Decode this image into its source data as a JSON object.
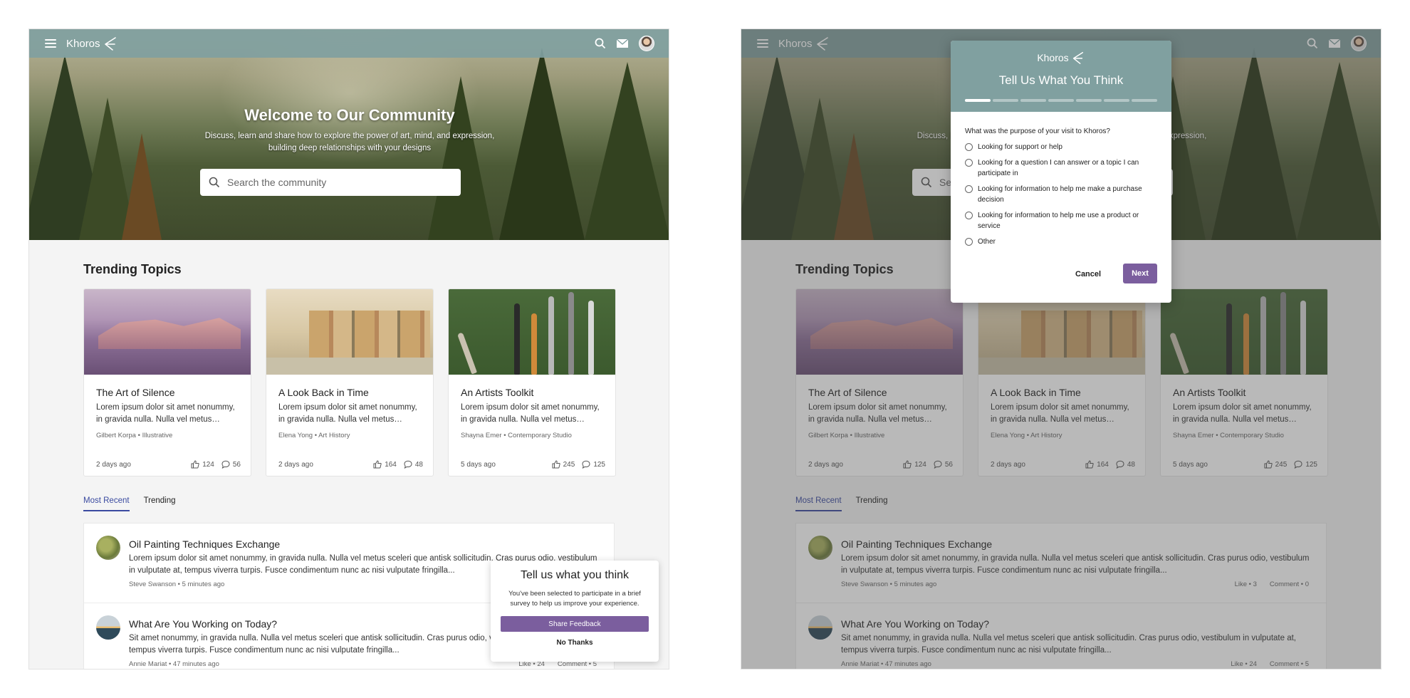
{
  "brand": {
    "name": "Khoros"
  },
  "hero": {
    "title": "Welcome to Our Community",
    "subtitle": "Discuss, learn and share how to explore the power of art, mind, and expression, building deep relationships with your designs",
    "search_placeholder": "Search the community"
  },
  "trending": {
    "title": "Trending Topics",
    "cards": [
      {
        "title": "The Art of Silence",
        "desc": "Lorem ipsum dolor sit amet nonummy, in gravida nulla. Nulla vel metus…",
        "meta": "Gilbert Korpa • Illustrative",
        "time": "2 days ago",
        "likes": "124",
        "comments": "56"
      },
      {
        "title": "A Look Back in Time",
        "desc": "Lorem ipsum dolor sit amet nonummy, in gravida nulla. Nulla vel metus…",
        "meta": "Elena Yong • Art History",
        "time": "2 days ago",
        "likes": "164",
        "comments": "48"
      },
      {
        "title": "An Artists Toolkit",
        "desc": "Lorem ipsum dolor sit amet nonummy, in gravida nulla. Nulla vel metus…",
        "meta": "Shayna Emer • Contemporary Studio",
        "time": "5 days ago",
        "likes": "245",
        "comments": "125"
      }
    ]
  },
  "tabs": {
    "most_recent": "Most Recent",
    "trending": "Trending"
  },
  "posts": [
    {
      "title": "Oil Painting Techniques Exchange",
      "body": "Lorem ipsum dolor sit amet nonummy, in gravida nulla. Nulla vel metus sceleri que antisk sollicitudin. Cras purus odio, vestibulum in vulputate at, tempus viverra turpis. Fusce condimentum nunc ac nisi vulputate fringilla...",
      "meta": "Steve Swanson • 5 minutes ago",
      "likes": "Like • 3",
      "comments": "Comment • 0"
    },
    {
      "title": "What Are You Working on Today?",
      "body": "Sit amet nonummy, in gravida nulla. Nulla vel metus sceleri que antisk sollicitudin. Cras purus odio, vestibulum in vulputate at, tempus viverra turpis. Fusce condimentum nunc ac nisi vulputate fringilla...",
      "meta": "Annie Mariat • 47 minutes ago",
      "likes": "Like • 24",
      "comments": "Comment • 5"
    }
  ],
  "toast": {
    "title": "Tell us what you think",
    "text": "You've been selected to participate in a brief survey to help us improve your experience.",
    "share_button": "Share Feedback",
    "no_thanks": "No Thanks"
  },
  "survey": {
    "title": "Tell Us What You Think",
    "steps_total": 7,
    "steps_done": 1,
    "question": "What was the purpose of your visit to Khoros?",
    "options": [
      "Looking for support or help",
      "Looking for a question I can answer or a topic I can participate in",
      "Looking for information to help me make a purchase decision",
      "Looking for information to help me use a product or service",
      "Other"
    ],
    "cancel": "Cancel",
    "next": "Next"
  },
  "colors": {
    "header": "#80a0a0",
    "accent": "#7b5e9e",
    "tab_active": "#3a4aa0"
  }
}
